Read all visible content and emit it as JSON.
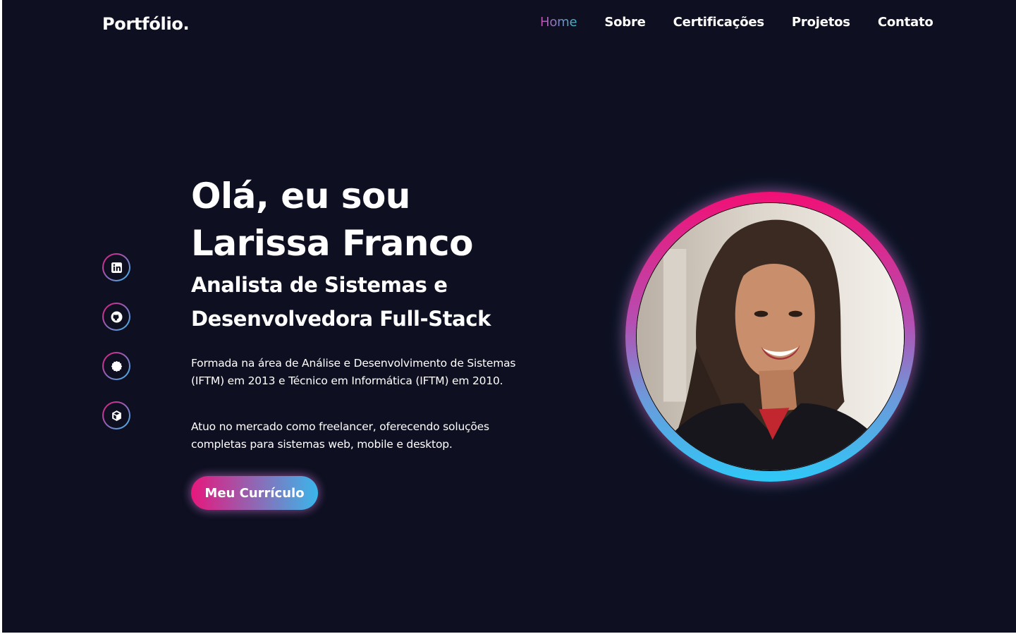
{
  "header": {
    "logo": "Portfólio.",
    "nav": [
      "Home",
      "Sobre",
      "Certificações",
      "Projetos",
      "Contato"
    ],
    "active_nav": "Home"
  },
  "socials": [
    {
      "icon": "linkedin-icon"
    },
    {
      "icon": "github-icon"
    },
    {
      "icon": "badge-icon"
    },
    {
      "icon": "cube-icon"
    }
  ],
  "hero": {
    "greeting_line1": "Olá, eu sou",
    "greeting_line2": "Larissa Franco",
    "role_line1": "Analista de Sistemas e",
    "role_line2": "Desenvolvedora Full-Stack",
    "description1": "Formada na área de Análise e Desenvolvimento de Sistemas (IFTM) em 2013 e Técnico em Informática (IFTM) em 2010.",
    "description2": "Atuo no mercado como freelancer, oferecendo soluções completas para sistemas web, mobile e desktop.",
    "cv_button": "Meu Currículo"
  },
  "colors": {
    "background": "#0e1021",
    "accent_pink": "#f20f75",
    "accent_blue": "#2ec8f7",
    "text": "#ffffff"
  }
}
